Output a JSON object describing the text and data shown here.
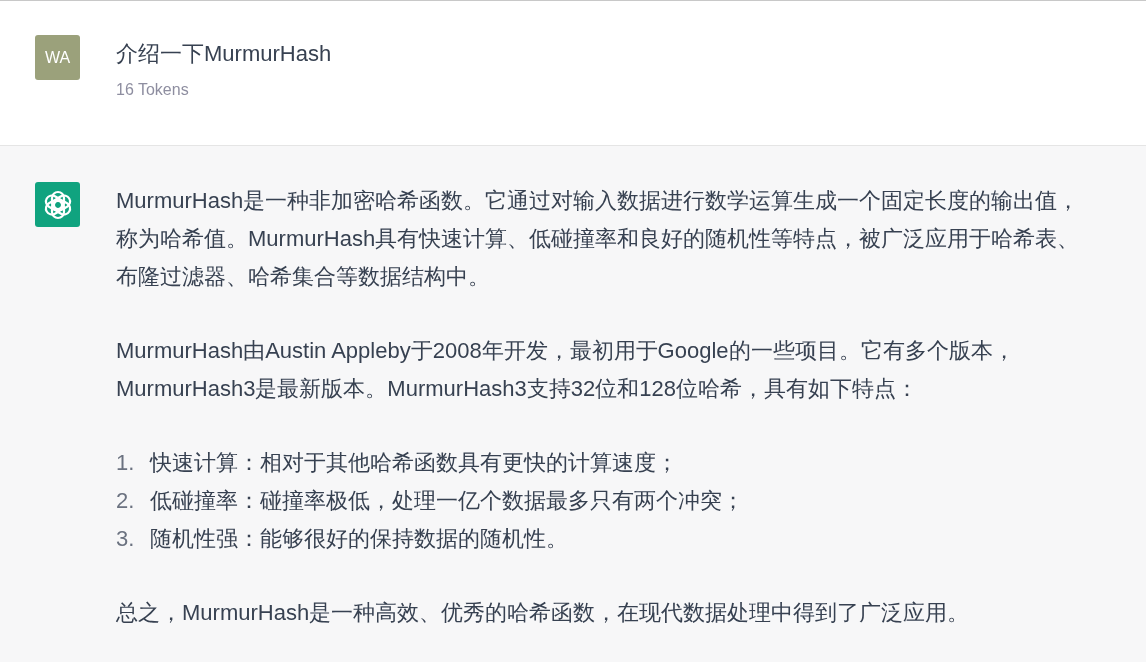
{
  "user_message": {
    "avatar_initials": "WA",
    "text": "介绍一下MurmurHash",
    "tokens": "16 Tokens"
  },
  "assistant_message": {
    "blocks": [
      {
        "kind": "paragraph",
        "text": "MurmurHash是一种非加密哈希函数。它通过对输入数据进行数学运算生成一个固定长度的输出值，称为哈希值。MurmurHash具有快速计算、低碰撞率和良好的随机性等特点，被广泛应用于哈希表、布隆过滤器、哈希集合等数据结构中。"
      },
      {
        "kind": "paragraph",
        "text": "MurmurHash由Austin Appleby于2008年开发，最初用于Google的一些项目。它有多个版本，MurmurHash3是最新版本。MurmurHash3支持32位和128位哈希，具有如下特点："
      },
      {
        "kind": "list",
        "items": [
          {
            "marker": "1.",
            "text": "快速计算：相对于其他哈希函数具有更快的计算速度；"
          },
          {
            "marker": "2.",
            "text": "低碰撞率：碰撞率极低，处理一亿个数据最多只有两个冲突；"
          },
          {
            "marker": "3.",
            "text": "随机性强：能够很好的保持数据的随机性。"
          }
        ]
      },
      {
        "kind": "paragraph",
        "text": "总之，MurmurHash是一种高效、优秀的哈希函数，在现代数据处理中得到了广泛应用。"
      }
    ]
  }
}
